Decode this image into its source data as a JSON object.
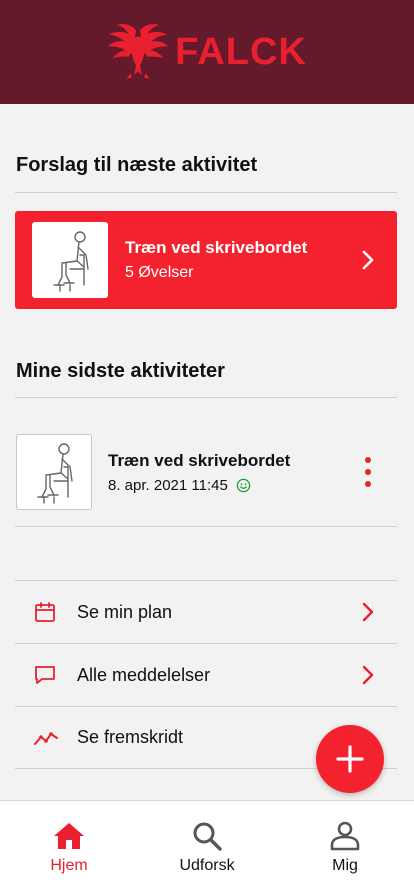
{
  "brand": {
    "name": "FALCK",
    "color": "#e8202f",
    "header_bg": "#651a2b"
  },
  "suggestion": {
    "heading": "Forslag til næste aktivitet",
    "card": {
      "title": "Træn ved skrivebordet",
      "subtitle": "5 Øvelser"
    }
  },
  "recent": {
    "heading": "Mine sidste aktiviteter",
    "items": [
      {
        "title": "Træn ved skrivebordet",
        "date": "8. apr. 2021 11:45",
        "mood_icon": "smiley-icon"
      }
    ]
  },
  "menu": {
    "items": [
      {
        "label": "Se min plan",
        "icon": "calendar-icon"
      },
      {
        "label": "Alle meddelelser",
        "icon": "chat-icon"
      },
      {
        "label": "Se fremskridt",
        "icon": "trend-icon"
      }
    ]
  },
  "fab": {
    "icon": "plus-icon"
  },
  "tabbar": {
    "tabs": [
      {
        "label": "Hjem",
        "icon": "home-icon",
        "active": true
      },
      {
        "label": "Udforsk",
        "icon": "search-icon",
        "active": false
      },
      {
        "label": "Mig",
        "icon": "person-icon",
        "active": false
      }
    ]
  }
}
